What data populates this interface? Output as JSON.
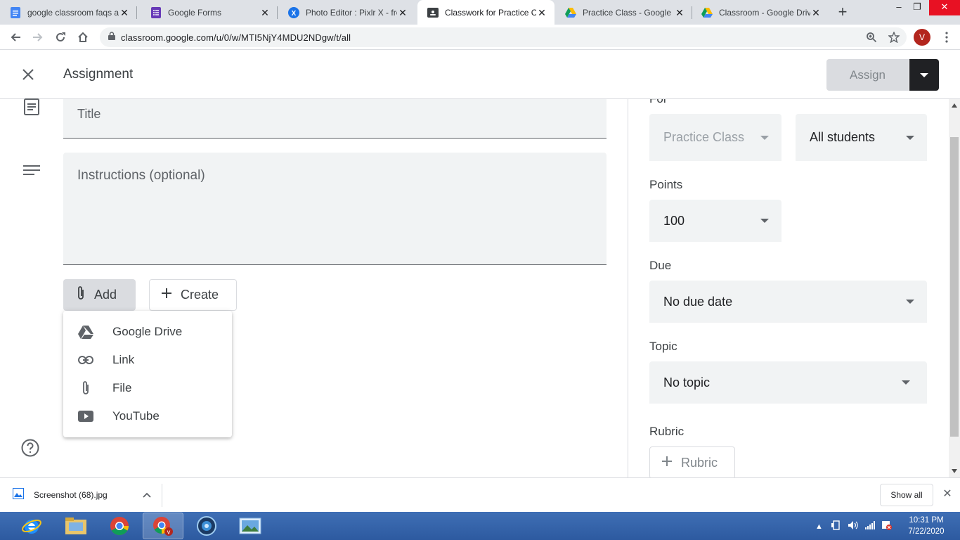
{
  "browser": {
    "tabs": [
      {
        "label": "google classroom faqs a",
        "icon": "google-docs-icon",
        "active": false
      },
      {
        "label": "Google Forms",
        "icon": "google-forms-icon",
        "active": false
      },
      {
        "label": "Photo Editor : Pixlr X - fre",
        "icon": "pixlr-icon",
        "active": false
      },
      {
        "label": "Classwork for Practice Cl",
        "icon": "classroom-icon",
        "active": true
      },
      {
        "label": "Practice Class - Google D",
        "icon": "google-drive-icon",
        "active": false
      },
      {
        "label": "Classroom - Google Driv",
        "icon": "google-drive-icon",
        "active": false
      }
    ],
    "url": "classroom.google.com/u/0/w/MTI5NjY4MDU2NDgw/t/all",
    "profile_initial": "V"
  },
  "header": {
    "title": "Assignment",
    "assign_label": "Assign"
  },
  "form": {
    "title_placeholder": "Title",
    "instructions_placeholder": "Instructions (optional)",
    "add_label": "Add",
    "create_label": "Create",
    "add_menu": [
      {
        "label": "Google Drive",
        "icon": "google-drive-icon"
      },
      {
        "label": "Link",
        "icon": "link-icon"
      },
      {
        "label": "File",
        "icon": "paperclip-icon"
      },
      {
        "label": "YouTube",
        "icon": "youtube-icon"
      }
    ]
  },
  "settings": {
    "for_label": "For",
    "class_value": "Practice Class",
    "students_value": "All students",
    "points_label": "Points",
    "points_value": "100",
    "due_label": "Due",
    "due_value": "No due date",
    "topic_label": "Topic",
    "topic_value": "No topic",
    "rubric_label": "Rubric",
    "rubric_button": "Rubric"
  },
  "downloads": {
    "file_name": "Screenshot (68).jpg",
    "show_all": "Show all"
  },
  "taskbar": {
    "time": "10:31 PM",
    "date": "7/22/2020"
  },
  "colors": {
    "accent_dark": "#202124",
    "field_bg": "#f1f3f4",
    "taskbar_blue": "#2d5aa0"
  }
}
